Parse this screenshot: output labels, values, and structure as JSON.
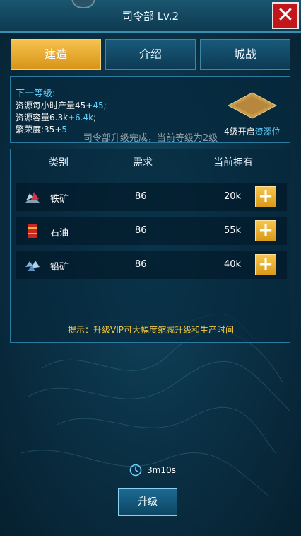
{
  "header": {
    "title": "司令部 Lv.2",
    "close_label": "✕"
  },
  "tabs": [
    {
      "label": "建造",
      "active": true
    },
    {
      "label": "介绍",
      "active": false
    },
    {
      "label": "城战",
      "active": false
    }
  ],
  "next_level": {
    "title": "下一等级:",
    "lines": [
      {
        "text": "资源每小时产量45+",
        "bonus": "45",
        "suffix": ";"
      },
      {
        "text": "资源容量6.3k+",
        "bonus": "6.4k",
        "suffix": ";"
      },
      {
        "text": "繁荣度:35+",
        "bonus": "5",
        "suffix": ""
      }
    ],
    "unlock_prefix": "4级开启",
    "unlock_highlight": "资源位"
  },
  "toast": "司令部升级完成，当前等级为2级",
  "resource_table": {
    "headers": {
      "category": "类别",
      "need": "需求",
      "owned": "当前拥有"
    },
    "rows": [
      {
        "icon": "iron-ore-icon",
        "name": "铁矿",
        "need": "86",
        "owned": "20k",
        "add": "+"
      },
      {
        "icon": "oil-barrel-icon",
        "name": "石油",
        "need": "86",
        "owned": "55k",
        "add": "+"
      },
      {
        "icon": "lead-ore-icon",
        "name": "铅矿",
        "need": "86",
        "owned": "40k",
        "add": "+"
      }
    ],
    "tip": "提示：升级VIP可大幅度缩减升级和生产时间"
  },
  "timer": {
    "icon": "clock-icon",
    "text": "3m10s"
  },
  "upgrade_button": {
    "label": "升级"
  },
  "colors": {
    "gold": "#f4c845",
    "cyan": "#5fd1ff",
    "close_red": "#c2161b"
  }
}
